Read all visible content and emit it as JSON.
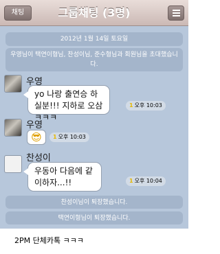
{
  "header": {
    "back_label": "채팅",
    "title": "그룹채팅 (3명)"
  },
  "notices": {
    "date": "2012년 1월 14일 토요일",
    "invite": "우영님이 택연이형님, 찬성이님, 준수형님과 회원님을 초대했습니다.",
    "leave1": "찬성이님이 퇴장했습니다.",
    "leave2": "택연이형님이 퇴장했습니다."
  },
  "messages": [
    {
      "sender": "우영",
      "text": "yo 나랑 출연승 하실분!!! 지하로 오삼ㅋㅋㅋ",
      "time": "오후 10:03",
      "unread": "1"
    },
    {
      "sender": "우영",
      "emoji": "😎",
      "time": "오후 10:03",
      "unread": "1"
    },
    {
      "sender": "찬성이",
      "text": "우동아 다음에 같이하자...!!",
      "time": "오후 10:04",
      "unread": "1"
    }
  ],
  "caption": "2PM 단체카톡 ㅋㅋㅋ"
}
